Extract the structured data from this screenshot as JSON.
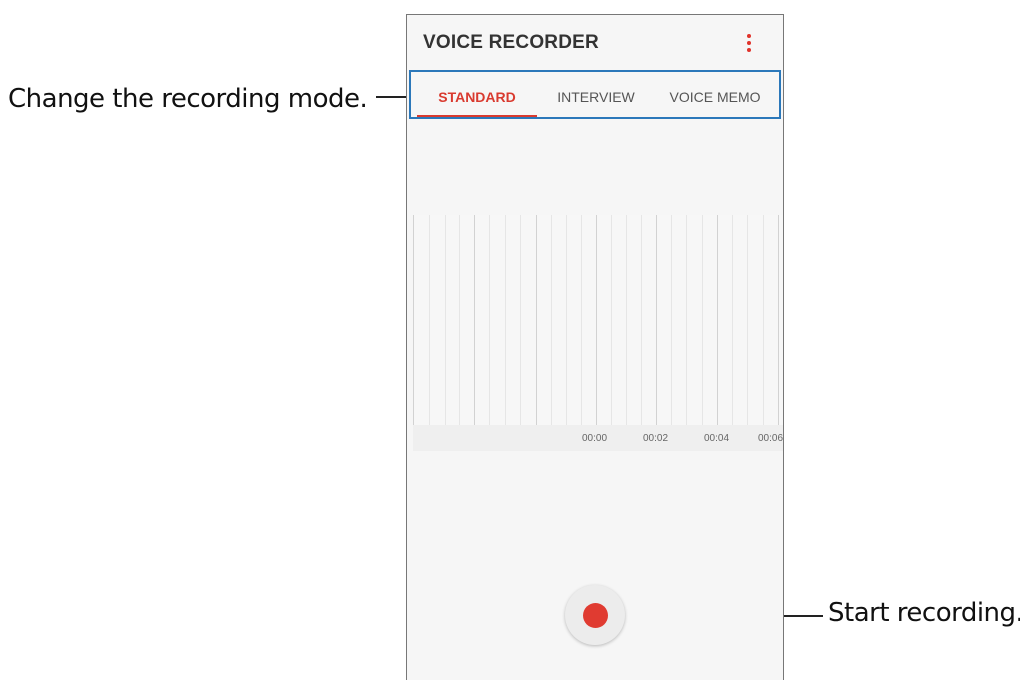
{
  "callouts": {
    "mode": "Change the recording mode.",
    "record": "Start recording."
  },
  "header": {
    "title": "VOICE RECORDER",
    "menu_icon": "more-vert-icon"
  },
  "tabs": [
    {
      "label": "STANDARD",
      "active": true
    },
    {
      "label": "INTERVIEW",
      "active": false
    },
    {
      "label": "VOICE MEMO",
      "active": false
    }
  ],
  "timeline": {
    "labels": [
      "00:00",
      "00:02",
      "00:04",
      "00:06"
    ]
  },
  "record_button": {
    "icon": "record-icon"
  },
  "colors": {
    "accent": "#d93a2f",
    "callout_box": "#2b78ba"
  }
}
